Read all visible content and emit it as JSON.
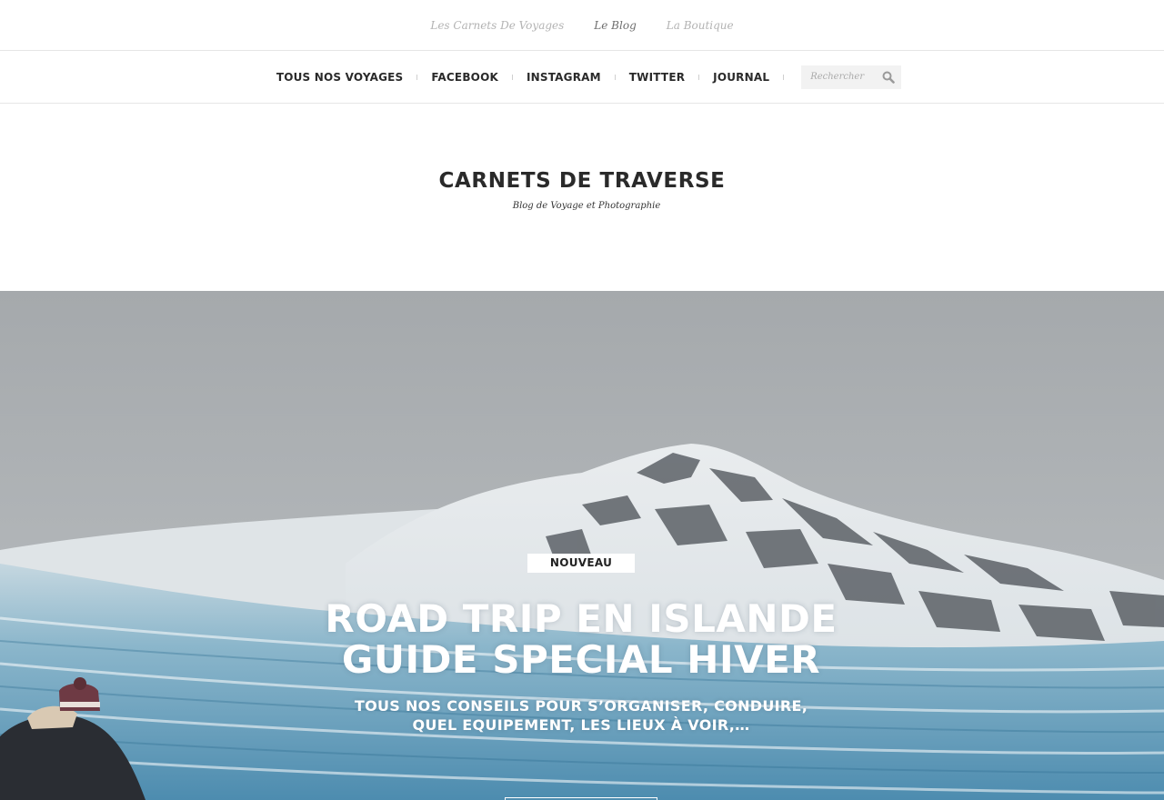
{
  "topbar": {
    "links": [
      {
        "label": "Les Carnets De Voyages"
      },
      {
        "label": "Le Blog"
      },
      {
        "label": "La Boutique"
      }
    ]
  },
  "nav": {
    "items": [
      {
        "label": "TOUS NOS VOYAGES"
      },
      {
        "label": "FACEBOOK"
      },
      {
        "label": "INSTAGRAM"
      },
      {
        "label": "TWITTER"
      },
      {
        "label": "JOURNAL"
      }
    ],
    "search": {
      "placeholder": "Rechercher",
      "icon": "search-icon"
    }
  },
  "site": {
    "title": "CARNETS DE TRAVERSE",
    "tagline": "Blog de Voyage et Photographie"
  },
  "hero": {
    "badge": "NOUVEAU",
    "title_line1": "ROAD TRIP EN ISLANDE",
    "title_line2": "GUIDE SPECIAL HIVER",
    "subtitle_line1": "TOUS NOS CONSEILS POUR S’ORGANISER, CONDUIRE,",
    "subtitle_line2": "QUEL EQUIPEMENT, LES LIEUX À VOIR,…"
  },
  "colors": {
    "nav_text": "#2a2a2a",
    "toplink_inactive": "#b3b3b3",
    "toplink_active": "#6e6e6e",
    "divider": "#e6e6e6",
    "sky": "#a9adb0",
    "ice": "#5f9ab8"
  }
}
